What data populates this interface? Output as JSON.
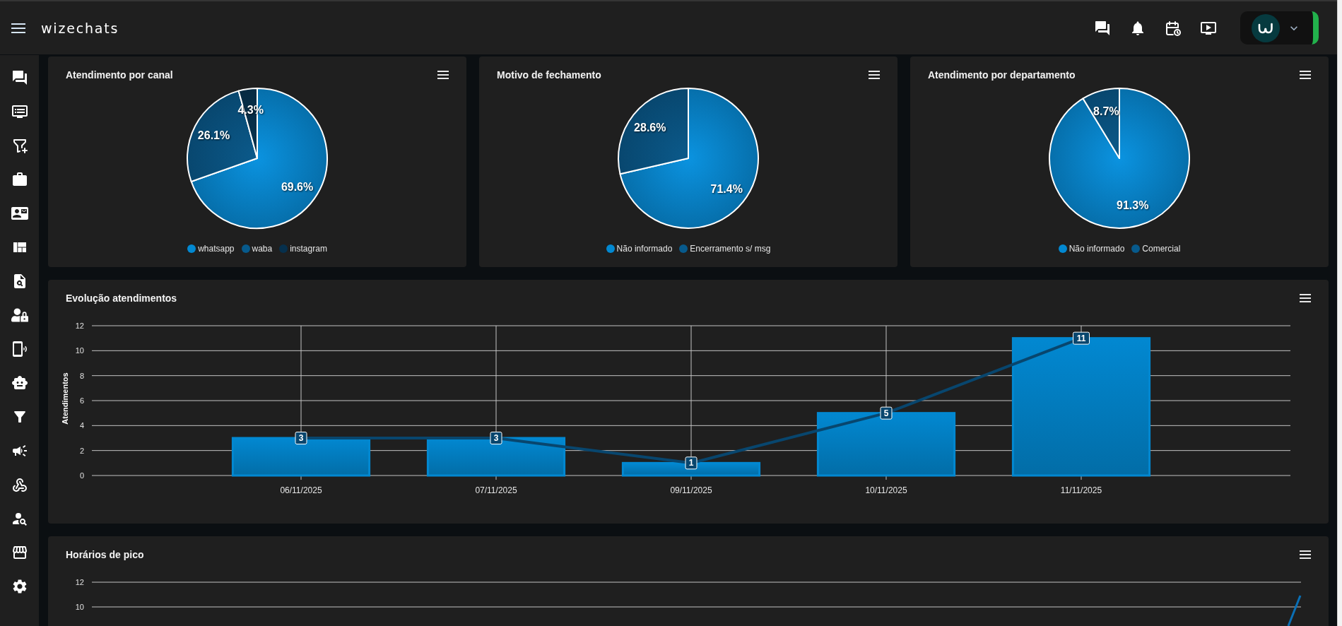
{
  "header": {
    "brand": "wizechats"
  },
  "pie_cards": [
    {
      "title": "Atendimento por canal",
      "chart_data": {
        "type": "pie",
        "categories": [
          "whatsapp",
          "waba",
          "instagram"
        ],
        "values": [
          69.6,
          26.1,
          4.3
        ],
        "value_labels": [
          "69.6%",
          "26.1%",
          "4.3%"
        ],
        "legend": true
      }
    },
    {
      "title": "Motivo de fechamento",
      "chart_data": {
        "type": "pie",
        "categories": [
          "Não informado",
          "Encerramento s/ msg"
        ],
        "values": [
          71.4,
          28.6
        ],
        "value_labels": [
          "71.4%",
          "28.6%"
        ],
        "legend": true
      }
    },
    {
      "title": "Atendimento por departamento",
      "chart_data": {
        "type": "pie",
        "categories": [
          "Não informado",
          "Comercial"
        ],
        "values": [
          91.3,
          8.7
        ],
        "value_labels": [
          "91.3%",
          "8.7%"
        ],
        "legend": true
      }
    }
  ],
  "evolution": {
    "title": "Evolução atendimentos",
    "chart_data": {
      "type": "bar",
      "ylabel": "Atendimentos",
      "categories": [
        "06/11/2025",
        "07/11/2025",
        "09/11/2025",
        "10/11/2025",
        "11/11/2025"
      ],
      "series": [
        {
          "type": "bar",
          "color": "#0288d1",
          "values": [
            3,
            3,
            1,
            5,
            11
          ]
        },
        {
          "type": "line",
          "color": "#08466e",
          "marker": "square",
          "values": [
            3,
            3,
            1,
            5,
            11
          ],
          "value_labels": [
            "3",
            "3",
            "1",
            "5",
            "11"
          ]
        }
      ],
      "ylim": [
        0,
        12
      ],
      "yticks": [
        {
          "value": 0,
          "label": "0"
        },
        {
          "value": 2,
          "label": "2"
        },
        {
          "value": 4,
          "label": "4"
        },
        {
          "value": 6,
          "label": "6"
        },
        {
          "value": 8,
          "label": "8"
        },
        {
          "value": 10,
          "label": "10"
        },
        {
          "value": 12,
          "label": "12"
        }
      ],
      "grid": true
    }
  },
  "peak_hours": {
    "title": "Horários de pico",
    "y_tick_labels": [
      "12",
      "10"
    ]
  }
}
